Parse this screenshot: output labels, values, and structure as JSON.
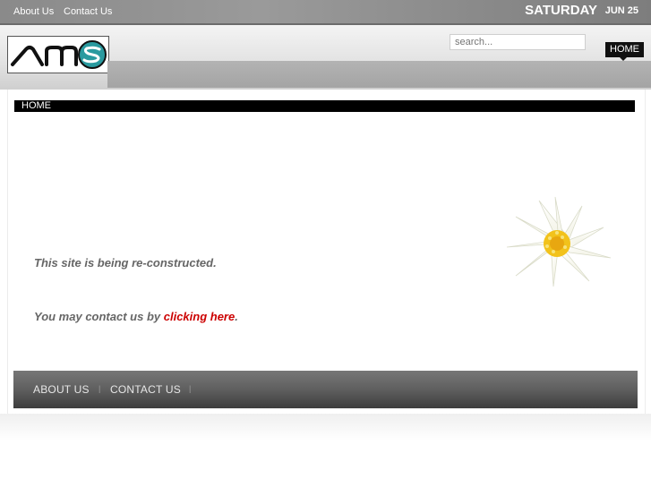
{
  "top_nav": {
    "about_label": "About Us",
    "contact_label": "Contact Us"
  },
  "date": {
    "weekday": "SATURDAY",
    "month_day": "JUN 25"
  },
  "logo": {
    "text": "AMS"
  },
  "search": {
    "placeholder": "search..."
  },
  "main_nav": {
    "home_label": "HOME"
  },
  "breadcrumb": {
    "label": "HOME"
  },
  "content": {
    "line1": "This site is being re-constructed.",
    "line2_prefix": "You may contact us by ",
    "line2_link": "clicking here",
    "line2_suffix": "."
  },
  "footer": {
    "about_label": "ABOUT US",
    "contact_label": "CONTACT US"
  },
  "colors": {
    "link_red": "#cc0000",
    "nav_dark": "#111111",
    "logo_teal": "#2a9a9f"
  }
}
